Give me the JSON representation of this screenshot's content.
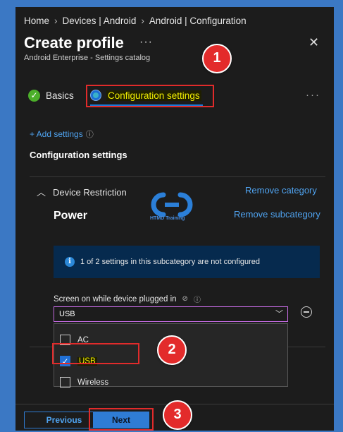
{
  "breadcrumb": [
    "Home",
    "Devices | Android",
    "Android | Configuration"
  ],
  "header": {
    "title": "Create profile",
    "more": "···",
    "subtitle": "Android Enterprise - Settings catalog",
    "close": "✕"
  },
  "annotations": [
    "1",
    "2",
    "3"
  ],
  "tabs": [
    {
      "label": "Basics",
      "status_icon": "check-icon"
    },
    {
      "label": "Configuration settings",
      "status_icon": "current-step-icon"
    }
  ],
  "tabs_more": "···",
  "add_settings": {
    "label": "+ Add settings",
    "info": "ⓘ"
  },
  "section_title": "Configuration settings",
  "category": {
    "name": "Device Restriction",
    "remove_label": "Remove category",
    "subcategory": "Power",
    "remove_sub_label": "Remove subcategory",
    "info_message": "1 of 2 settings in this subcategory are not configured"
  },
  "watermark": {
    "text": "HTMD Training"
  },
  "setting": {
    "label": "Screen on while device plugged in",
    "selected_value": "USB",
    "options": [
      {
        "label": "AC",
        "checked": false
      },
      {
        "label": "USB",
        "checked": true
      },
      {
        "label": "Wireless",
        "checked": false
      }
    ]
  },
  "footer": {
    "previous_label": "Previous",
    "next_label": "Next"
  },
  "colors": {
    "accent": "#2f7cd4",
    "link": "#4fa3f0",
    "highlight_box": "#e12b2b",
    "badge": "#e32b2b",
    "background_frame": "#3b78c4"
  }
}
